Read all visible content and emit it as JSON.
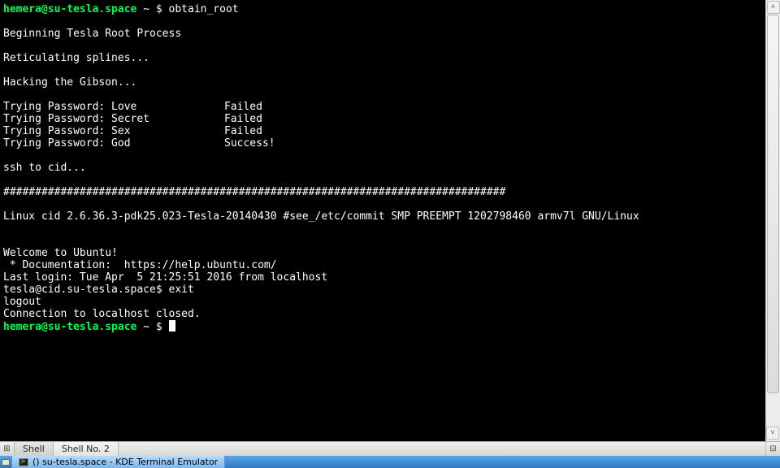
{
  "prompt": {
    "host": "hemera@su-tesla.space",
    "path": "~",
    "symbol": "$"
  },
  "command": "obtain_root",
  "output": {
    "begin": "Beginning Tesla Root Process",
    "splines": "Reticulating splines...",
    "gibson": "Hacking the Gibson...",
    "passwords": [
      {
        "label": "Trying Password: Love",
        "result": "Failed"
      },
      {
        "label": "Trying Password: Secret",
        "result": "Failed"
      },
      {
        "label": "Trying Password: Sex",
        "result": "Failed"
      },
      {
        "label": "Trying Password: God",
        "result": "Success!"
      }
    ],
    "ssh": "ssh to cid...",
    "bannerbar": "###############################################################################",
    "uname": "Linux cid 2.6.36.3-pdk25.023-Tesla-20140430 #see_/etc/commit SMP PREEMPT 1202798460 armv7l GNU/Linux",
    "welcome": "Welcome to Ubuntu!",
    "docs": " * Documentation:  https://help.ubuntu.com/",
    "lastlogin": "Last login: Tue Apr  5 21:25:51 2016 from localhost",
    "innerprompt": "tesla@cid.su-tesla.space$ exit",
    "logout": "logout",
    "closed": "Connection to localhost closed."
  },
  "tabs": {
    "new_icon": "⊞",
    "close_icon": "⊟",
    "items": [
      {
        "label": "Shell"
      },
      {
        "label": "Shell No. 2"
      }
    ]
  },
  "taskbar": {
    "window_title": "() su-tesla.space - KDE Terminal Emulator"
  }
}
